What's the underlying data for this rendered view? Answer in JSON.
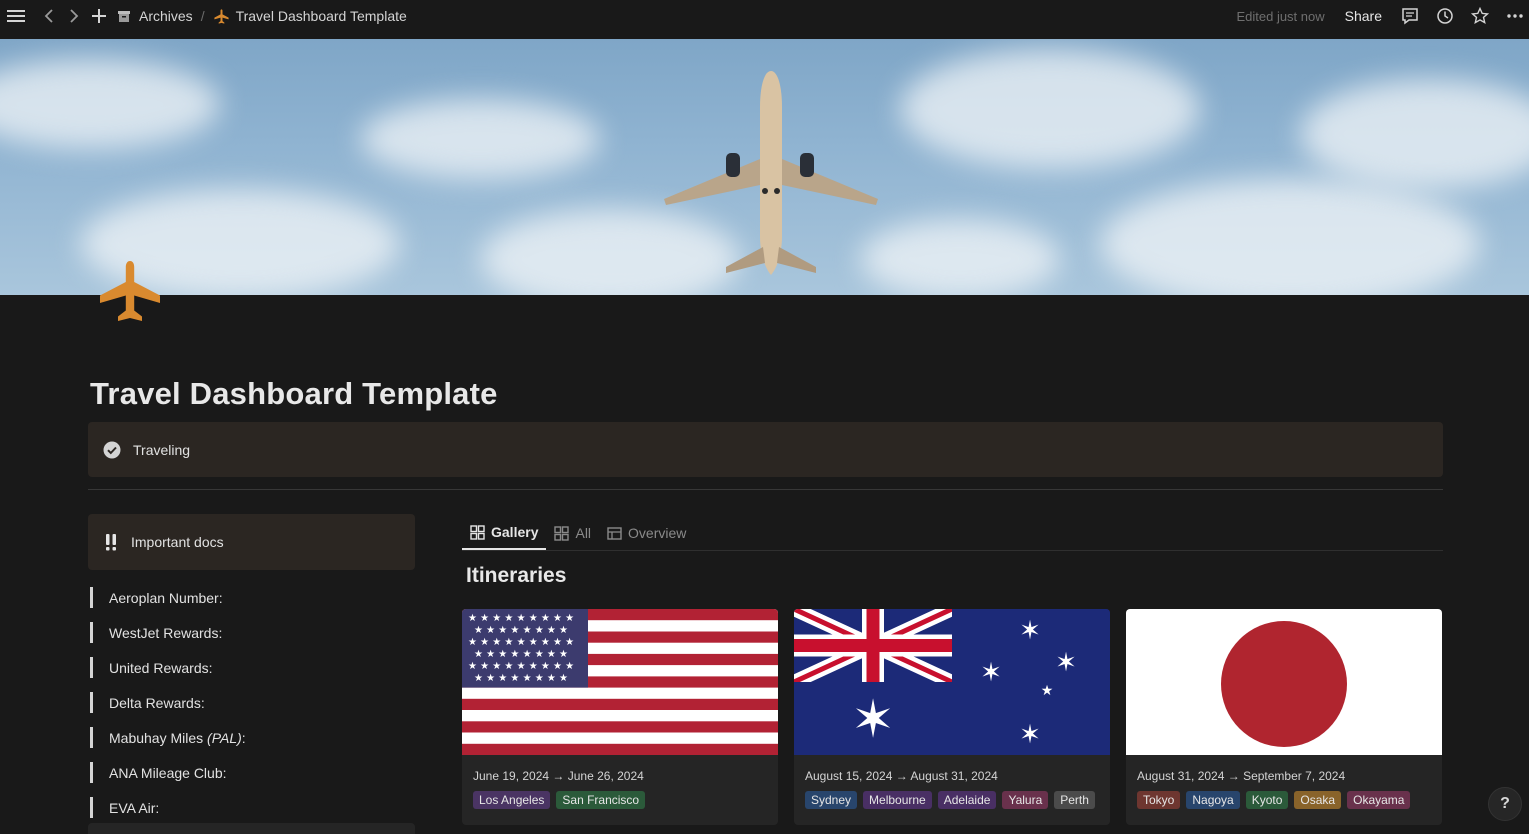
{
  "topbar": {
    "breadcrumb_archive": "Archives",
    "breadcrumb_sep": "/",
    "breadcrumb_page": "Travel Dashboard Template",
    "edited": "Edited just now",
    "share": "Share"
  },
  "page": {
    "title": "Travel Dashboard Template",
    "status_callout": "Traveling",
    "accent_color": "#d98a2f"
  },
  "docs": {
    "title": "Important docs",
    "items": [
      {
        "label": "Aeroplan Number:"
      },
      {
        "label": "WestJet Rewards:"
      },
      {
        "label": "United Rewards:"
      },
      {
        "label": "Delta Rewards:"
      },
      {
        "label_main": "Mabuhay Miles ",
        "label_italic": "(PAL)",
        "label_end": ":"
      },
      {
        "label": "ANA Mileage Club:"
      },
      {
        "label": "EVA Air:"
      }
    ]
  },
  "tabs": [
    {
      "label": "Gallery",
      "icon": "gallery-icon",
      "active": true
    },
    {
      "label": "All",
      "icon": "gallery-icon",
      "active": false
    },
    {
      "label": "Overview",
      "icon": "table-icon",
      "active": false
    }
  ],
  "section_title": "Itineraries",
  "cards": [
    {
      "flag": "usa-flag",
      "date": "June 19, 2024 → June 26, 2024",
      "tags": [
        {
          "label": "Los Angeles",
          "color": "#4a3463"
        },
        {
          "label": "San Francisco",
          "color": "#2b5a3a"
        }
      ]
    },
    {
      "flag": "australia-flag",
      "date": "August 15, 2024 → August 31, 2024",
      "tags": [
        {
          "label": "Sydney",
          "color": "#28456c"
        },
        {
          "label": "Melbourne",
          "color": "#492f64"
        },
        {
          "label": "Adelaide",
          "color": "#492f64"
        },
        {
          "label": "Yalura",
          "color": "#69314c"
        },
        {
          "label": "Perth",
          "color": "#4b4b4b"
        }
      ]
    },
    {
      "flag": "japan-flag",
      "date": "August 31, 2024 → September 7, 2024",
      "tags": [
        {
          "label": "Tokyo",
          "color": "#6e3630"
        },
        {
          "label": "Nagoya",
          "color": "#28456c"
        },
        {
          "label": "Kyoto",
          "color": "#2b5a3a"
        },
        {
          "label": "Osaka",
          "color": "#89632a"
        },
        {
          "label": "Okayama",
          "color": "#69314c"
        }
      ]
    }
  ],
  "help_label": "?"
}
